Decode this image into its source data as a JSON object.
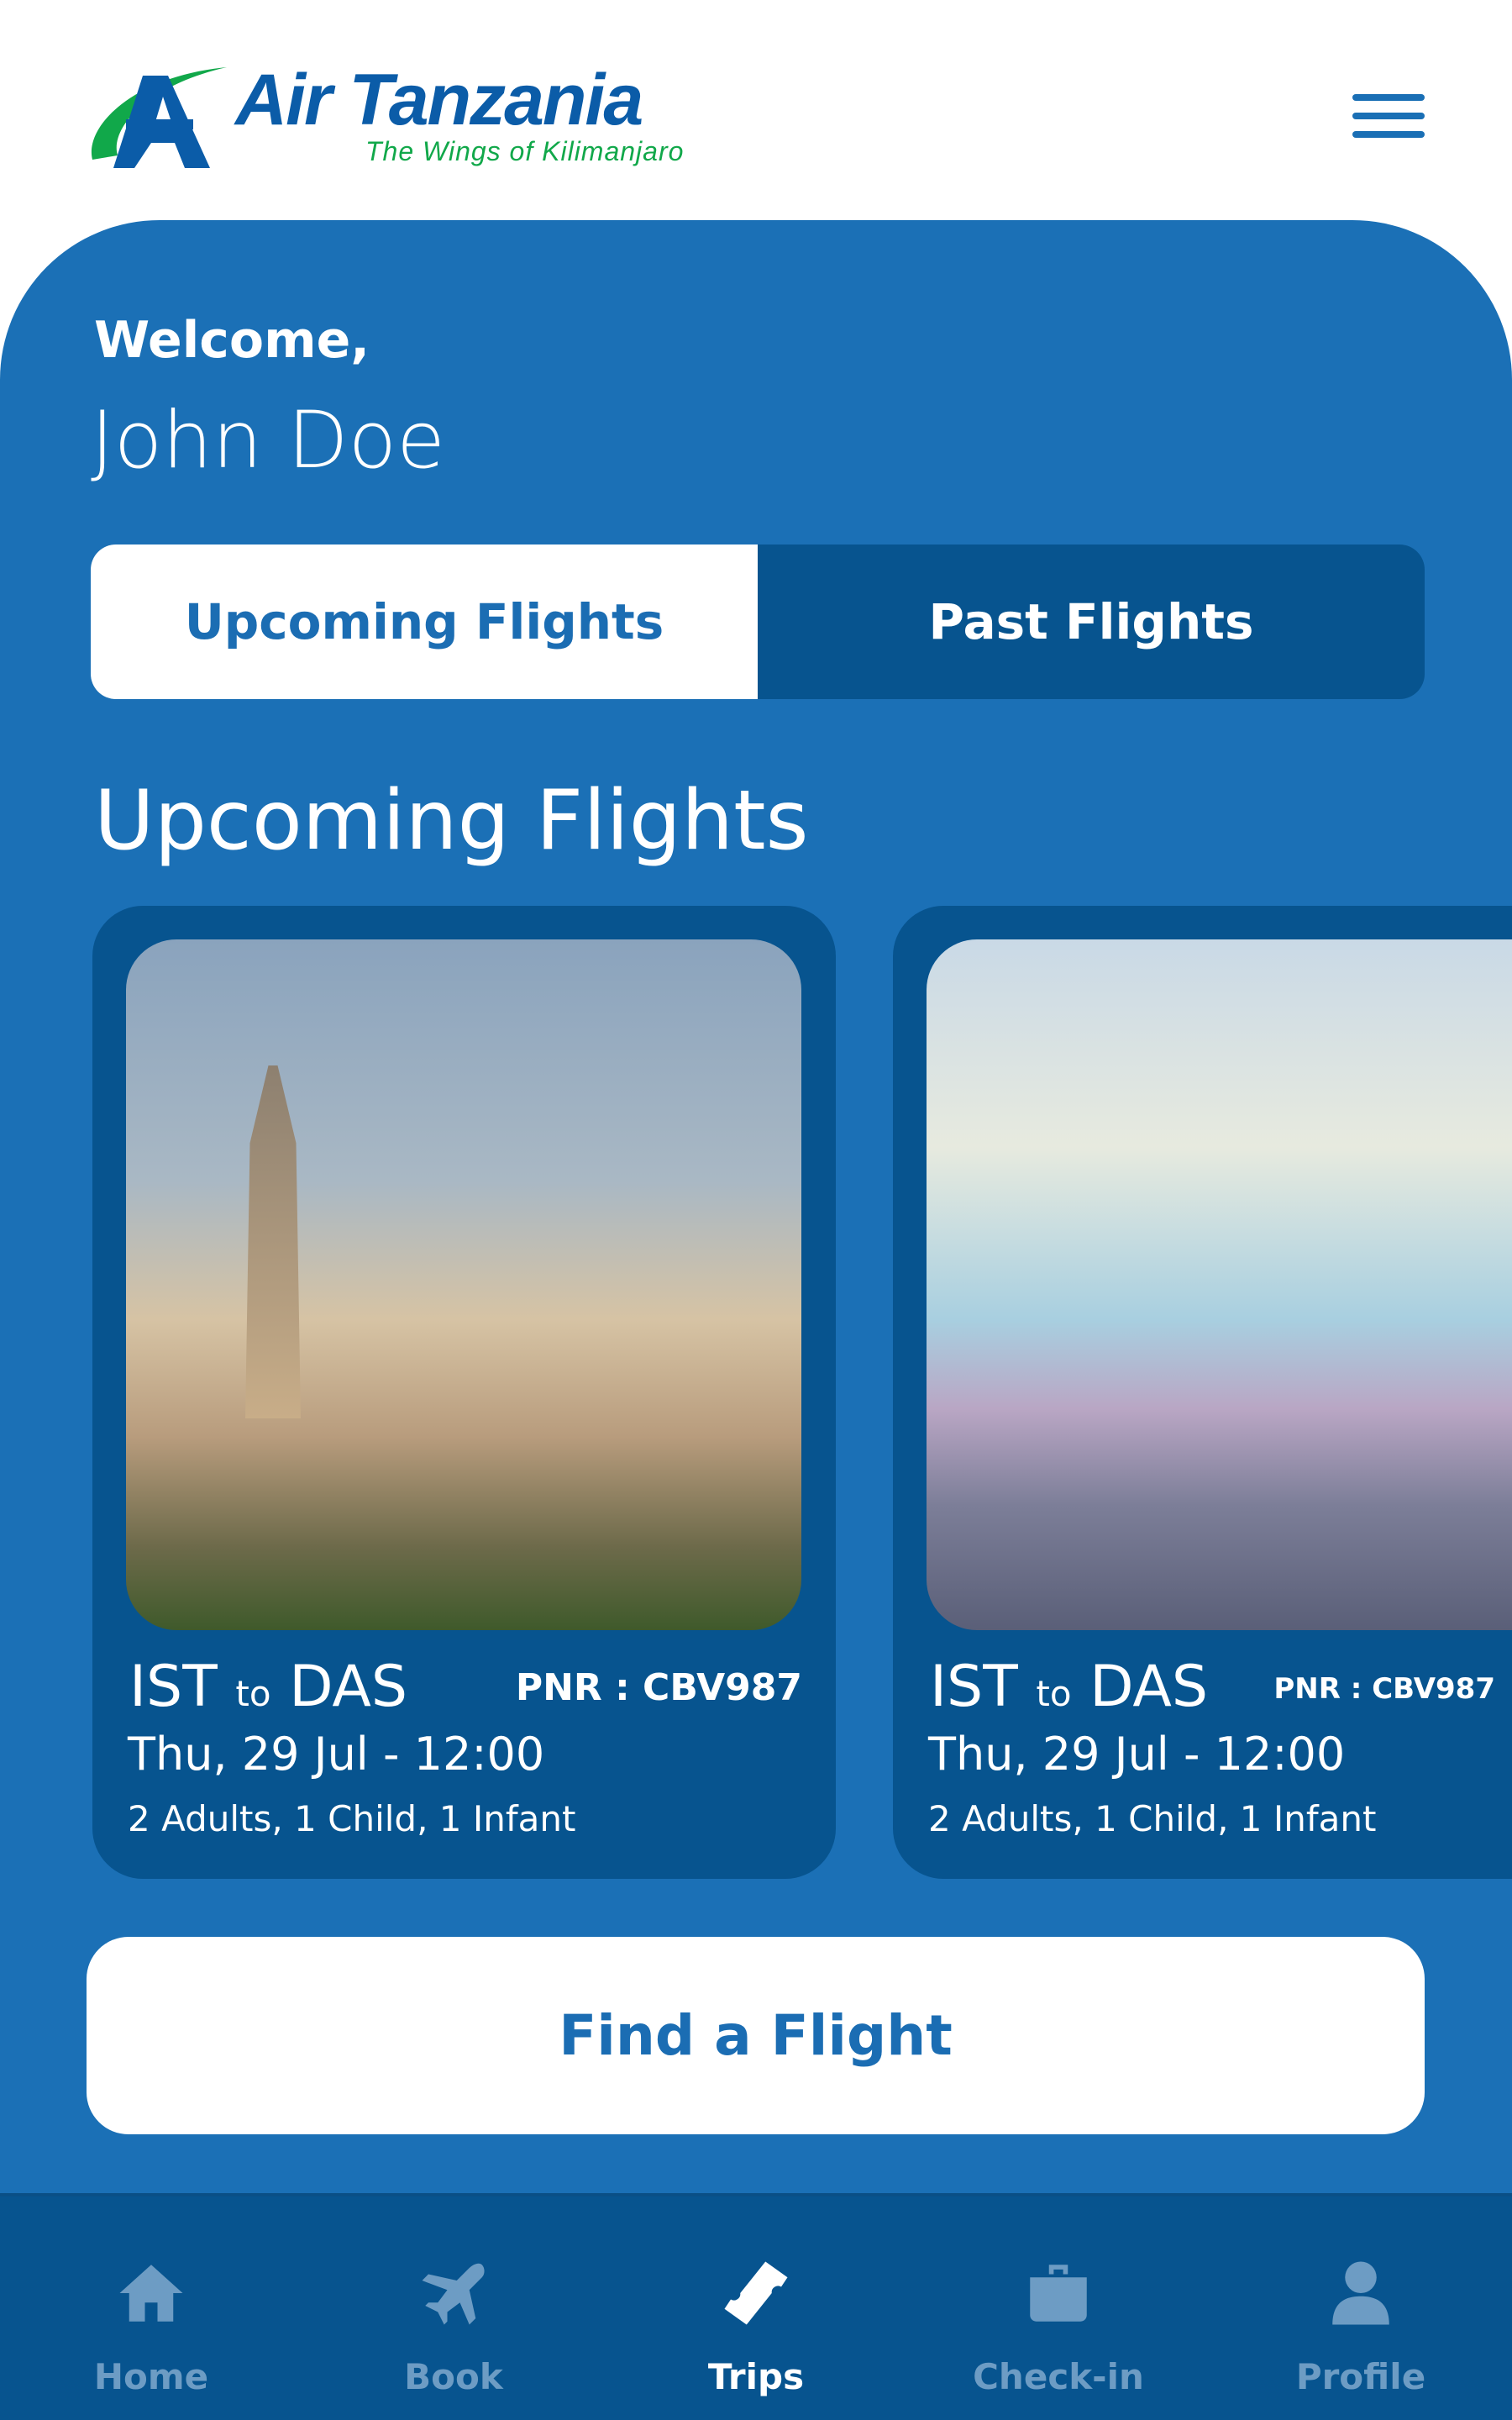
{
  "header": {
    "logo_brand": "Air Tanzania",
    "logo_tagline": "The Wings of Kilimanjaro",
    "menu_icon": "hamburger-menu-icon"
  },
  "welcome": {
    "greeting": "Welcome,",
    "user_name": "John Doe"
  },
  "tabs": [
    {
      "label": "Upcoming Flights",
      "active": true
    },
    {
      "label": "Past Flights",
      "active": false
    }
  ],
  "section_title": "Upcoming Flights",
  "flights": [
    {
      "origin": "IST",
      "connector": "to",
      "destination": "DAS",
      "pnr": "PNR : CBV987",
      "datetime": "Thu, 29 Jul - 12:00",
      "passengers": "2 Adults, 1 Child, 1 Infant"
    },
    {
      "origin": "IST",
      "connector": "to",
      "destination": "DAS",
      "pnr": "PNR : CBV987",
      "datetime": "Thu, 29 Jul - 12:00",
      "passengers": "2 Adults, 1 Child, 1 Infant"
    }
  ],
  "find_flight_label": "Find a Flight",
  "bottom_nav": [
    {
      "label": "Home",
      "icon": "home-icon",
      "active": false
    },
    {
      "label": "Book",
      "icon": "airplane-icon",
      "active": false
    },
    {
      "label": "Trips",
      "icon": "ticket-icon",
      "active": true
    },
    {
      "label": "Check-in",
      "icon": "briefcase-icon",
      "active": false
    },
    {
      "label": "Profile",
      "icon": "user-icon",
      "active": false
    }
  ],
  "colors": {
    "primary": "#1b70b6",
    "dark": "#07548f",
    "logo_green": "#11a84a"
  }
}
